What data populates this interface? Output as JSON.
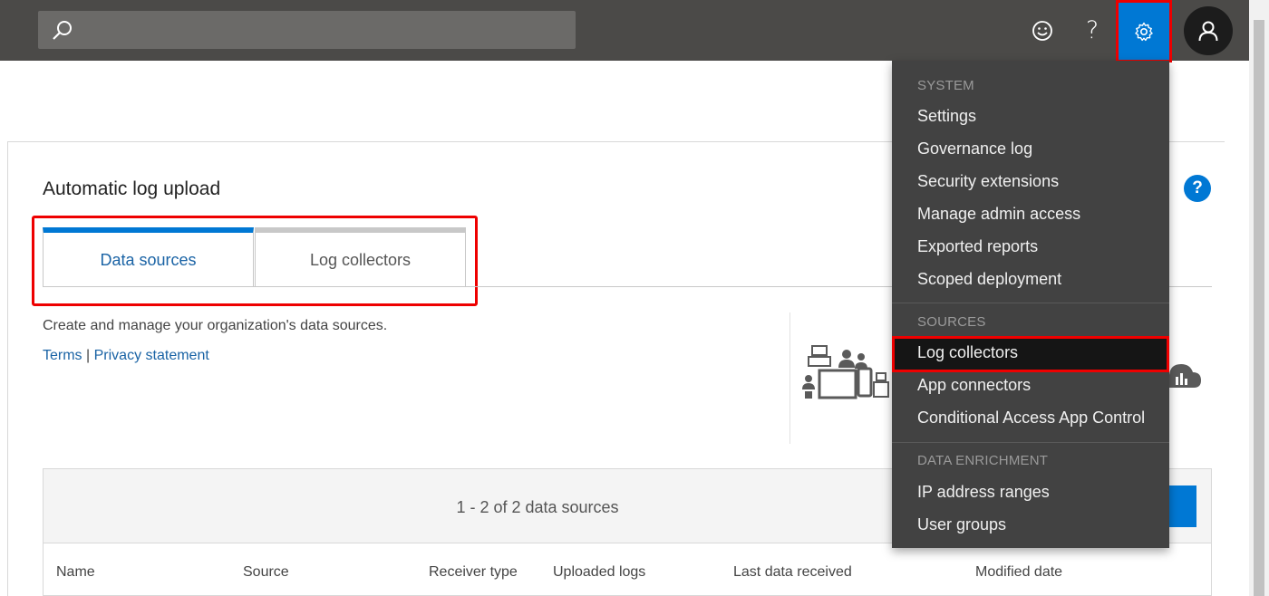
{
  "topbar": {
    "search_placeholder": "",
    "icons": [
      "search-icon",
      "smiley-icon",
      "help-icon",
      "gear-icon",
      "user-icon"
    ],
    "help_label": "?"
  },
  "page": {
    "title": "Automatic log upload",
    "tabs": [
      {
        "label": "Data sources",
        "active": true
      },
      {
        "label": "Log collectors",
        "active": false
      }
    ],
    "description": "Create and manage your organization's data sources.",
    "links": {
      "terms": "Terms",
      "separator": "|",
      "privacy": "Privacy statement"
    },
    "help_badge": "?"
  },
  "table": {
    "count_text": "1 - 2 of 2 data sources",
    "columns": [
      "Name",
      "Source",
      "Receiver type",
      "Uploaded logs",
      "Last data received",
      "Modified date"
    ]
  },
  "menu": {
    "sections": [
      {
        "title": "SYSTEM",
        "items": [
          "Settings",
          "Governance log",
          "Security extensions",
          "Manage admin access",
          "Exported reports",
          "Scoped deployment"
        ]
      },
      {
        "title": "SOURCES",
        "items": [
          "Log collectors",
          "App connectors",
          "Conditional Access App Control"
        ]
      },
      {
        "title": "DATA ENRICHMENT",
        "items": [
          "IP address ranges",
          "User groups"
        ]
      }
    ],
    "highlighted_item": "Log collectors"
  },
  "colors": {
    "topbar": "#4b4a48",
    "accent": "#0078d4",
    "menu_bg": "#424242",
    "highlight_border": "#e00000",
    "link": "#1a63a5"
  }
}
